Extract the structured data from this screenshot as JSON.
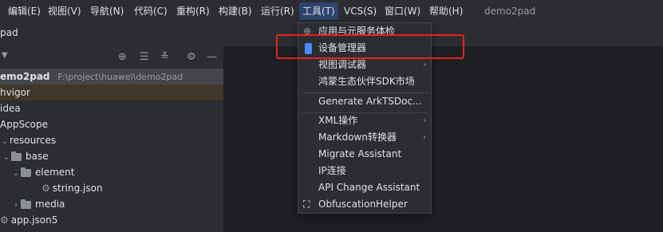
{
  "menubar": {
    "items": [
      {
        "label": "编辑(E)"
      },
      {
        "label": "视图(V)"
      },
      {
        "label": "导航(N)"
      },
      {
        "label": "代码(C)"
      },
      {
        "label": "重构(R)"
      },
      {
        "label": "构建(B)"
      },
      {
        "label": "运行(R)"
      },
      {
        "label": "工具(T)"
      },
      {
        "label": "VCS(S)"
      },
      {
        "label": "窗口(W)"
      },
      {
        "label": "帮助(H)"
      }
    ],
    "project": "demo2pad"
  },
  "navbar": {
    "text": "pad"
  },
  "panel": {
    "tree": [
      {
        "text": "emo2pad",
        "path": "F:\\project\\huawei\\demo2pad"
      },
      {
        "text": "hvigor"
      },
      {
        "text": "idea"
      },
      {
        "text": "AppScope"
      },
      {
        "text": "resources"
      },
      {
        "text": "base"
      },
      {
        "text": "element"
      },
      {
        "text": "string.json"
      },
      {
        "text": "media"
      },
      {
        "text": "app.json5"
      }
    ]
  },
  "tools_menu": {
    "items": [
      {
        "label": "应用与元服务体检"
      },
      {
        "label": "设备管理器"
      },
      {
        "label": "视图调试器"
      },
      {
        "label": "鸿蒙生态伙伴SDK市场"
      },
      {
        "label": "Generate ArkTSDoc..."
      },
      {
        "label": "XML操作"
      },
      {
        "label": "Markdown转换器"
      },
      {
        "label": "Migrate Assistant"
      },
      {
        "label": "IP连接"
      },
      {
        "label": "API Change Assistant"
      },
      {
        "label": "ObfuscationHelper"
      }
    ]
  },
  "colors": {
    "highlight_box": "#e52222",
    "active_menu": "#2e436e",
    "device_icon": "#4a8df8"
  }
}
